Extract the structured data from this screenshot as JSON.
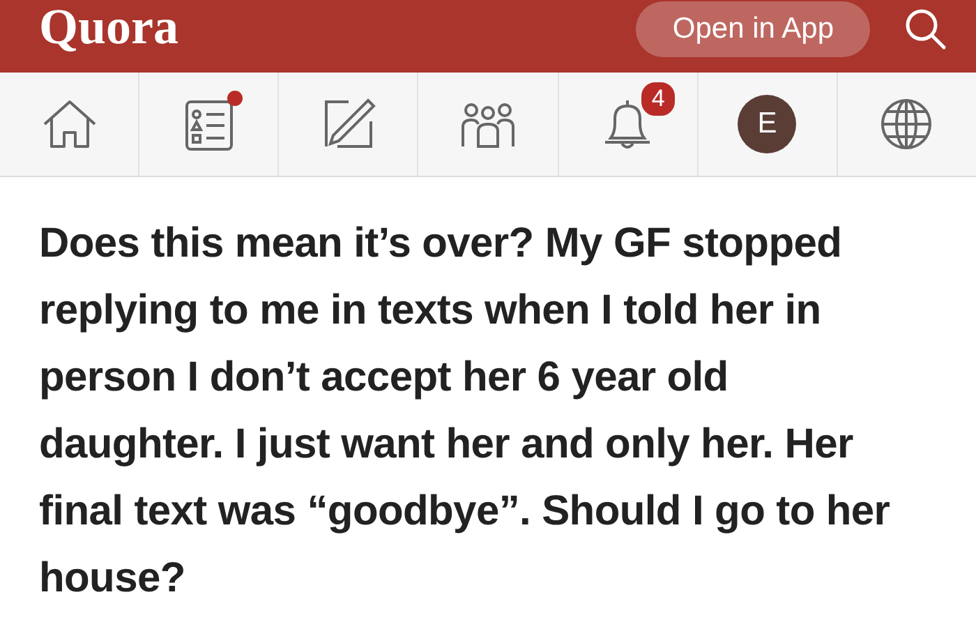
{
  "header": {
    "logo": "Quora",
    "open_in_app": "Open in App"
  },
  "nav": [
    {
      "kind": "home",
      "dot": false
    },
    {
      "kind": "feed",
      "dot": true
    },
    {
      "kind": "write",
      "dot": false
    },
    {
      "kind": "spaces",
      "dot": false
    },
    {
      "kind": "notifications",
      "dot": false,
      "badge": "4"
    },
    {
      "kind": "profile",
      "dot": false,
      "avatar": "E"
    },
    {
      "kind": "language",
      "dot": false
    }
  ],
  "question": "Does this mean it’s over? My GF stopped replying to me in texts when I told her in person I don’t accept her 6 year old daughter. I just want her and only her. Her final text was “goodbye”. Should I go to her house?"
}
